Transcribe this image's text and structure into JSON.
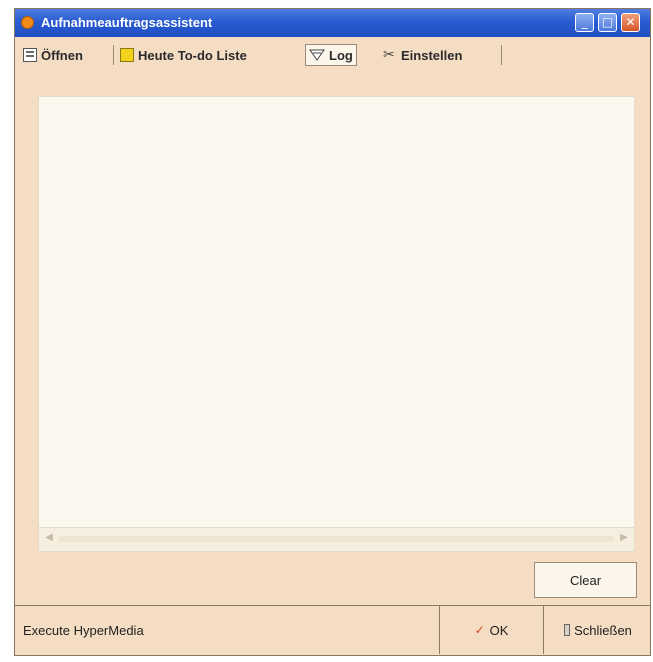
{
  "window": {
    "title": "Aufnahmeauftragsassistent"
  },
  "titlebar_buttons": {
    "minimize": "_",
    "maximize": "□",
    "close": "✕"
  },
  "tabs": [
    {
      "label": "Öffnen",
      "icon": "open-icon"
    },
    {
      "label": "Heute To-do Liste",
      "icon": "note-icon"
    },
    {
      "label": "Log",
      "icon": "log-icon",
      "active": true
    },
    {
      "label": "Einstellen",
      "icon": "tools-icon"
    }
  ],
  "log": {
    "content": ""
  },
  "scrollbar": {
    "left_arrow": "◀",
    "right_arrow": "▶"
  },
  "clear_label": "Clear",
  "footer": {
    "status": "Execute HyperMedia",
    "ok_label": "OK",
    "ok_icon": "✓",
    "close_label": "Schließen"
  }
}
